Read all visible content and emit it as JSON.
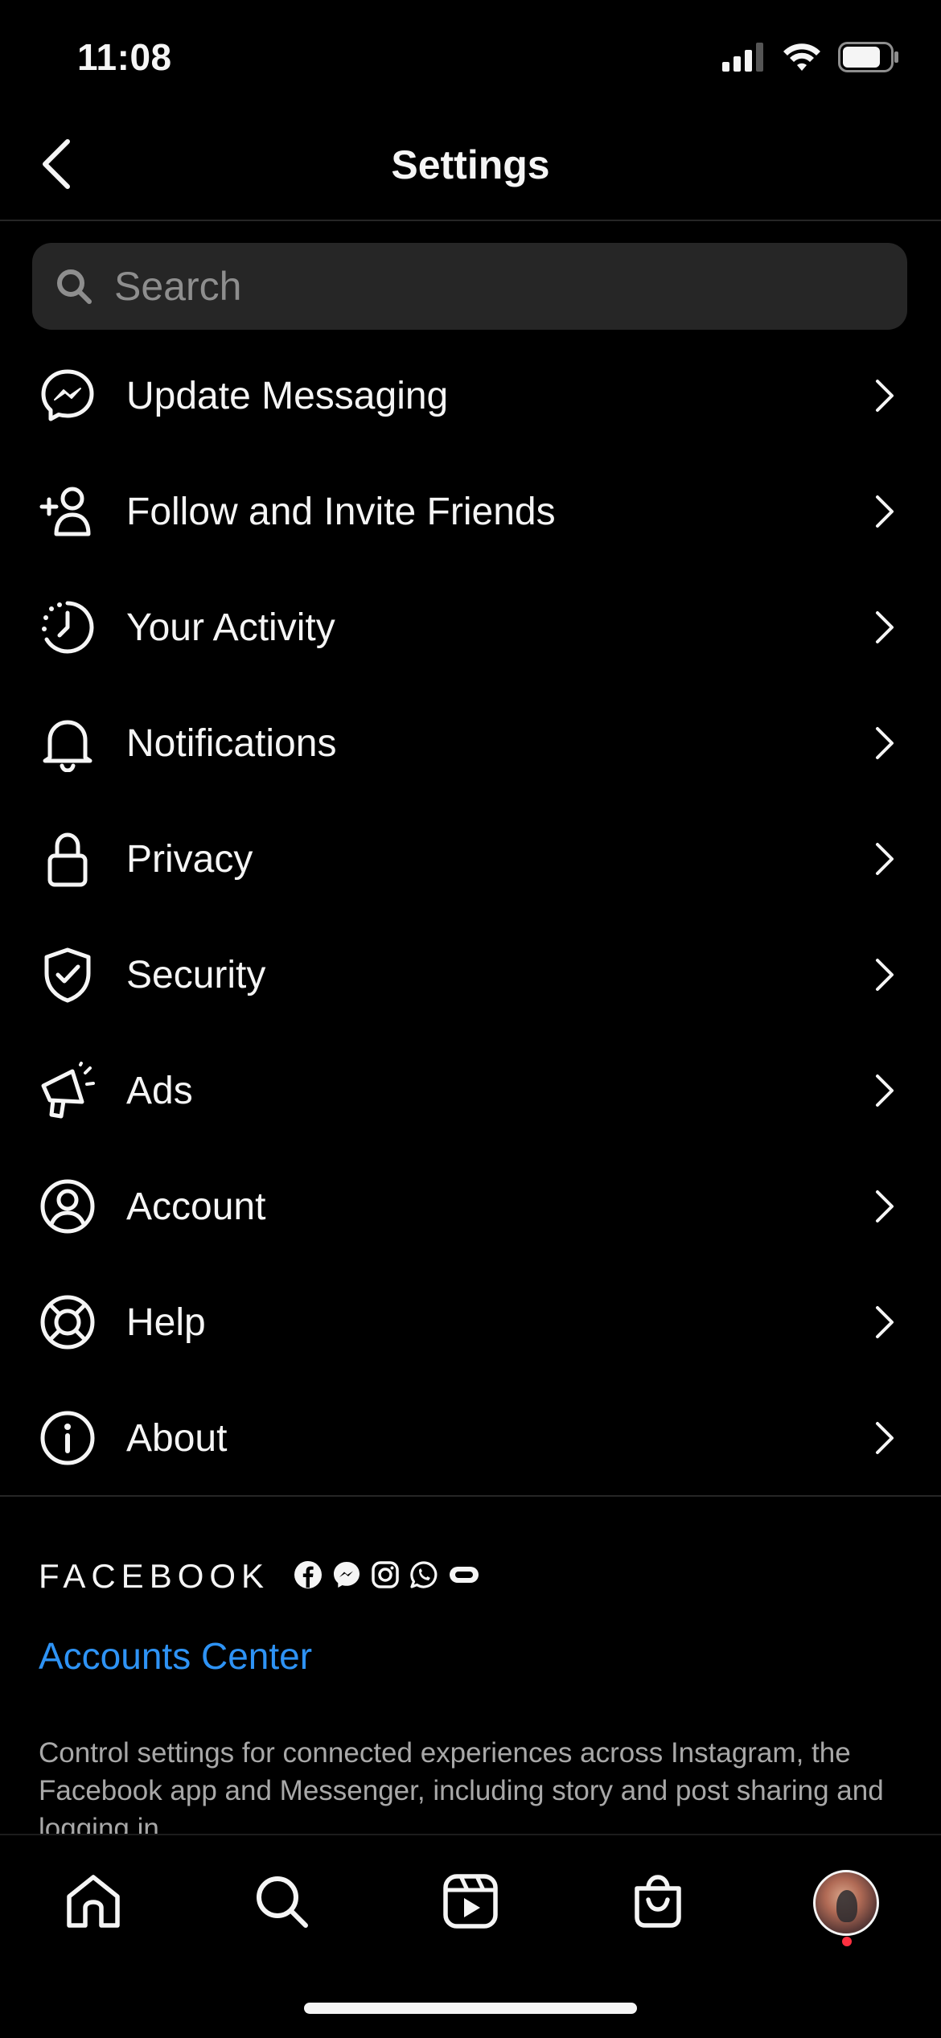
{
  "status_bar": {
    "time": "11:08"
  },
  "header": {
    "title": "Settings"
  },
  "search": {
    "placeholder": "Search",
    "value": ""
  },
  "settings_items": [
    {
      "label": "Update Messaging",
      "icon": "messenger-icon"
    },
    {
      "label": "Follow and Invite Friends",
      "icon": "add-person-icon"
    },
    {
      "label": "Your Activity",
      "icon": "activity-clock-icon"
    },
    {
      "label": "Notifications",
      "icon": "bell-icon"
    },
    {
      "label": "Privacy",
      "icon": "lock-icon"
    },
    {
      "label": "Security",
      "icon": "shield-check-icon"
    },
    {
      "label": "Ads",
      "icon": "megaphone-icon"
    },
    {
      "label": "Account",
      "icon": "account-circle-icon"
    },
    {
      "label": "Help",
      "icon": "lifebuoy-icon"
    },
    {
      "label": "About",
      "icon": "info-icon"
    }
  ],
  "facebook": {
    "wordmark": "FACEBOOK",
    "app_icons": [
      "facebook-icon",
      "messenger-icon",
      "instagram-icon",
      "whatsapp-icon",
      "portal-icon"
    ],
    "accounts_center": "Accounts Center",
    "description": "Control settings for connected experiences across Instagram, the Facebook app and Messenger, including story and post sharing and logging in."
  },
  "tab_bar": {
    "tabs": [
      "home-icon",
      "search-icon",
      "reels-icon",
      "shop-icon",
      "profile-avatar"
    ],
    "profile_notification": true
  },
  "colors": {
    "background": "#000000",
    "text": "#f5f5f5",
    "accent_link": "#2e93f5",
    "search_bg": "#262626",
    "secondary_text": "#a8a8a8",
    "notification_dot": "#ff3040"
  }
}
